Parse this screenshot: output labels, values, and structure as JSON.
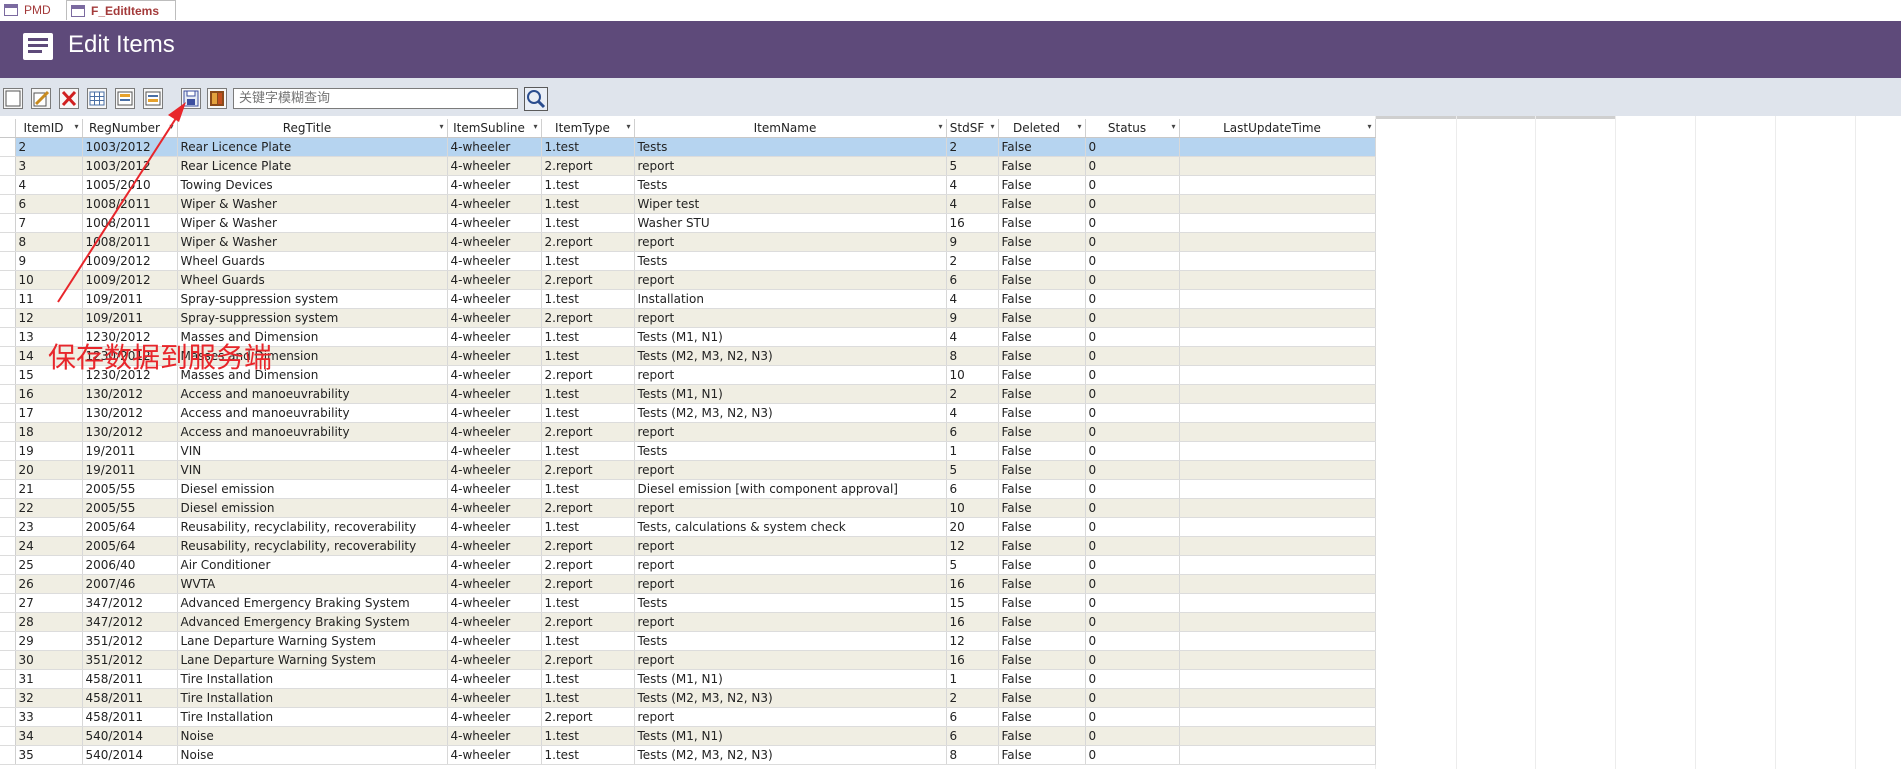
{
  "tabs": [
    {
      "label": "PMD",
      "active": false
    },
    {
      "label": "F_EditItems",
      "active": true
    }
  ],
  "header": {
    "title": "Edit Items"
  },
  "toolbar": {
    "buttons": [
      "new-record-icon",
      "edit-record-icon",
      "delete-icon",
      "datasheet-grid-icon",
      "form-view-icon",
      "form-edit-icon",
      "save-icon",
      "exit-icon"
    ],
    "search_placeholder": "关键字模糊查询"
  },
  "annotation": {
    "text": "保存数据到服务端",
    "color": "#e8262b"
  },
  "grid": {
    "columns": [
      "ItemID",
      "RegNumber",
      "RegTitle",
      "ItemSubline",
      "ItemType",
      "ItemName",
      "StdSF",
      "Deleted",
      "Status",
      "LastUpdateTime"
    ],
    "rows": [
      [
        "2",
        "1003/2012",
        "Rear Licence Plate",
        "4-wheeler",
        "1.test",
        "Tests",
        "2",
        "False",
        "0",
        ""
      ],
      [
        "3",
        "1003/2012",
        "Rear Licence Plate",
        "4-wheeler",
        "2.report",
        "report",
        "5",
        "False",
        "0",
        ""
      ],
      [
        "4",
        "1005/2010",
        "Towing Devices",
        "4-wheeler",
        "1.test",
        "Tests",
        "4",
        "False",
        "0",
        ""
      ],
      [
        "6",
        "1008/2011",
        "Wiper & Washer",
        "4-wheeler",
        "1.test",
        "Wiper test",
        "4",
        "False",
        "0",
        ""
      ],
      [
        "7",
        "1008/2011",
        "Wiper & Washer",
        "4-wheeler",
        "1.test",
        "Washer STU",
        "16",
        "False",
        "0",
        ""
      ],
      [
        "8",
        "1008/2011",
        "Wiper & Washer",
        "4-wheeler",
        "2.report",
        "report",
        "9",
        "False",
        "0",
        ""
      ],
      [
        "9",
        "1009/2012",
        "Wheel Guards",
        "4-wheeler",
        "1.test",
        "Tests",
        "2",
        "False",
        "0",
        ""
      ],
      [
        "10",
        "1009/2012",
        "Wheel Guards",
        "4-wheeler",
        "2.report",
        "report",
        "6",
        "False",
        "0",
        ""
      ],
      [
        "11",
        "109/2011",
        "Spray-suppression system",
        "4-wheeler",
        "1.test",
        "Installation",
        "4",
        "False",
        "0",
        ""
      ],
      [
        "12",
        "109/2011",
        "Spray-suppression system",
        "4-wheeler",
        "2.report",
        "report",
        "9",
        "False",
        "0",
        ""
      ],
      [
        "13",
        "1230/2012",
        "Masses and Dimension",
        "4-wheeler",
        "1.test",
        "Tests (M1, N1)",
        "4",
        "False",
        "0",
        ""
      ],
      [
        "14",
        "1230/2012",
        "Masses and Dimension",
        "4-wheeler",
        "1.test",
        "Tests (M2, M3, N2, N3)",
        "8",
        "False",
        "0",
        ""
      ],
      [
        "15",
        "1230/2012",
        "Masses and Dimension",
        "4-wheeler",
        "2.report",
        "report",
        "10",
        "False",
        "0",
        ""
      ],
      [
        "16",
        "130/2012",
        "Access and manoeuvrability",
        "4-wheeler",
        "1.test",
        "Tests (M1, N1)",
        "2",
        "False",
        "0",
        ""
      ],
      [
        "17",
        "130/2012",
        "Access and manoeuvrability",
        "4-wheeler",
        "1.test",
        "Tests (M2, M3, N2, N3)",
        "4",
        "False",
        "0",
        ""
      ],
      [
        "18",
        "130/2012",
        "Access and manoeuvrability",
        "4-wheeler",
        "2.report",
        "report",
        "6",
        "False",
        "0",
        ""
      ],
      [
        "19",
        "19/2011",
        "VIN",
        "4-wheeler",
        "1.test",
        "Tests",
        "1",
        "False",
        "0",
        ""
      ],
      [
        "20",
        "19/2011",
        "VIN",
        "4-wheeler",
        "2.report",
        "report",
        "5",
        "False",
        "0",
        ""
      ],
      [
        "21",
        "2005/55",
        "Diesel emission",
        "4-wheeler",
        "1.test",
        "Diesel emission [with component approval]",
        "6",
        "False",
        "0",
        ""
      ],
      [
        "22",
        "2005/55",
        "Diesel emission",
        "4-wheeler",
        "2.report",
        "report",
        "10",
        "False",
        "0",
        ""
      ],
      [
        "23",
        "2005/64",
        "Reusability, recyclability, recoverability",
        "4-wheeler",
        "1.test",
        "Tests, calculations & system check",
        "20",
        "False",
        "0",
        ""
      ],
      [
        "24",
        "2005/64",
        "Reusability, recyclability, recoverability",
        "4-wheeler",
        "2.report",
        "report",
        "12",
        "False",
        "0",
        ""
      ],
      [
        "25",
        "2006/40",
        "Air Conditioner",
        "4-wheeler",
        "2.report",
        "report",
        "5",
        "False",
        "0",
        ""
      ],
      [
        "26",
        "2007/46",
        "WVTA",
        "4-wheeler",
        "2.report",
        "report",
        "16",
        "False",
        "0",
        ""
      ],
      [
        "27",
        "347/2012",
        "Advanced Emergency Braking System",
        "4-wheeler",
        "1.test",
        "Tests",
        "15",
        "False",
        "0",
        ""
      ],
      [
        "28",
        "347/2012",
        "Advanced Emergency Braking System",
        "4-wheeler",
        "2.report",
        "report",
        "16",
        "False",
        "0",
        ""
      ],
      [
        "29",
        "351/2012",
        "Lane Departure Warning System",
        "4-wheeler",
        "1.test",
        "Tests",
        "12",
        "False",
        "0",
        ""
      ],
      [
        "30",
        "351/2012",
        "Lane Departure Warning System",
        "4-wheeler",
        "2.report",
        "report",
        "16",
        "False",
        "0",
        ""
      ],
      [
        "31",
        "458/2011",
        "Tire Installation",
        "4-wheeler",
        "1.test",
        "Tests (M1, N1)",
        "1",
        "False",
        "0",
        ""
      ],
      [
        "32",
        "458/2011",
        "Tire Installation",
        "4-wheeler",
        "1.test",
        "Tests (M2, M3, N2, N3)",
        "2",
        "False",
        "0",
        ""
      ],
      [
        "33",
        "458/2011",
        "Tire Installation",
        "4-wheeler",
        "2.report",
        "report",
        "6",
        "False",
        "0",
        ""
      ],
      [
        "34",
        "540/2014",
        "Noise",
        "4-wheeler",
        "1.test",
        "Tests (M1, N1)",
        "6",
        "False",
        "0",
        ""
      ],
      [
        "35",
        "540/2014",
        "Noise",
        "4-wheeler",
        "1.test",
        "Tests (M2, M3, N2, N3)",
        "8",
        "False",
        "0",
        ""
      ]
    ]
  },
  "colors": {
    "header_bg": "#5e4a7a",
    "toolbar_bg": "#dfe4ec",
    "selected_row": "#b6d4f0",
    "alt_row": "#f0eee3"
  }
}
